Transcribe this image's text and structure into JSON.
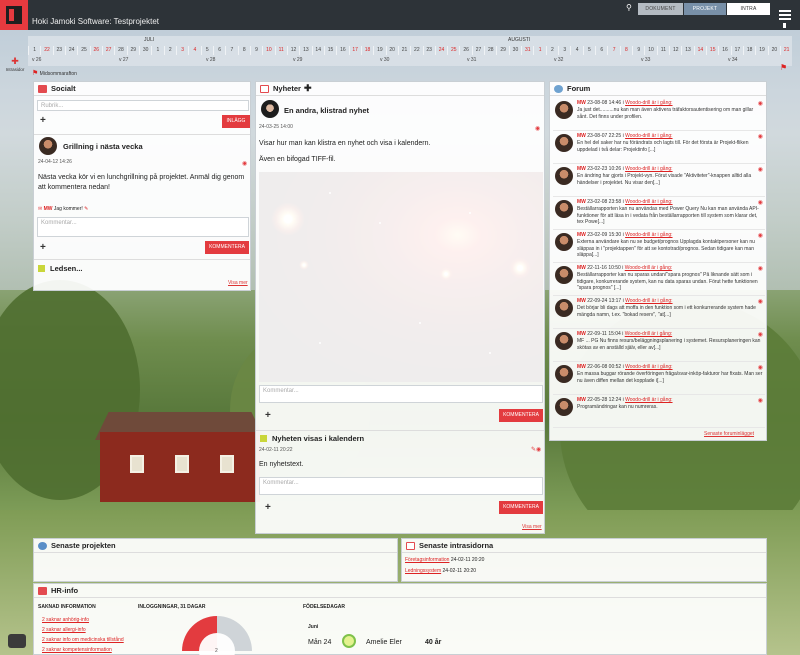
{
  "app": {
    "title": "Hoki Jamoki Software: Testprojektet"
  },
  "toptabs": [
    "DOKUMENT",
    "PROJEKT",
    "INTRA"
  ],
  "timeline": {
    "months": [
      "JULI",
      "AUGUSTI"
    ],
    "days": [
      "1",
      "22",
      "23",
      "24",
      "25",
      "26",
      "27",
      "28",
      "29",
      "30",
      "1",
      "2",
      "3",
      "4",
      "5",
      "6",
      "7",
      "8",
      "9",
      "10",
      "11",
      "12",
      "13",
      "14",
      "15",
      "16",
      "17",
      "18",
      "19",
      "20",
      "21",
      "22",
      "23",
      "24",
      "25",
      "26",
      "27",
      "28",
      "29",
      "30",
      "31",
      "1",
      "2",
      "3",
      "4",
      "5",
      "6",
      "7",
      "8",
      "9",
      "10",
      "11",
      "12",
      "13",
      "14",
      "15",
      "16",
      "17",
      "18",
      "19",
      "20",
      "21"
    ],
    "weeks": [
      "v 26",
      "v 27",
      "v 28",
      "v 29",
      "v 30",
      "v 31",
      "v 32",
      "v 33",
      "v 34"
    ],
    "left_label": "Intrasidor",
    "event": "Midsommarafton"
  },
  "social": {
    "title": "Socialt",
    "input_placeholder": "Rubrik...",
    "post_button": "INLÄGG",
    "post_title": "Grillning i nästa vecka",
    "post_date": "24-04-12 14:26",
    "post_text": "Nästa vecka kör vi en lunchgrillning på projektet. Anmäl dig genom att kommentera nedan!",
    "comment_author": "MW",
    "comment_text": "Jag kommer!",
    "comment_placeholder": "Kommentar...",
    "comment_button": "KOMMENTERA",
    "section2_title": "Ledsen...",
    "more_link": "Visa mer"
  },
  "news": {
    "title": "Nyheter",
    "item1_title": "En andra, klistrad nyhet",
    "item1_date": "24-03-25 14:00",
    "item1_text1": "Visar hur man kan klistra en nyhet och visa i kalendern.",
    "item1_text2": "Även en bifogad TIFF-fil.",
    "comment_placeholder": "Kommentar...",
    "comment_button": "KOMMENTERA",
    "item2_title": "Nyheten visas i kalendern",
    "item2_date": "24-02-11 20:22",
    "item2_text": "En nyhetstext.",
    "more_link": "Visa mer"
  },
  "forum": {
    "title": "Forum",
    "items": [
      {
        "meta_who": "MW",
        "meta_date": "23-08-08 14:46 i",
        "meta_link": "Woodo-drill är i gång:",
        "text": "Ja just det..........nu kan man även aktivera träfaktorsautentisering om man gillar sånt. Det finns under profilen."
      },
      {
        "meta_who": "MW",
        "meta_date": "23-08-07 22:25 i",
        "meta_link": "Woodo-drill är i gång:",
        "text": "En hel del saker har nu förändrats och lagts till. För det första är Projekt-fliken uppdelad i två delar: Projektinfo [...]"
      },
      {
        "meta_who": "MW",
        "meta_date": "23-02-23 10:26 i",
        "meta_link": "Woodo-drill är i gång:",
        "text": "En ändring har gjorts i Projekt-vyn. Förut visade \"Aktiviteter\"-knappen alltid alla händelser i projektet. Nu visar den[...]"
      },
      {
        "meta_who": "MW",
        "meta_date": "23-02-08 23:58 i",
        "meta_link": "Woodo-drill är i gång:",
        "text": "Beställarrapporten kan nu användas med Power Query Nu kan man använda API-funktioner för att läsa in i vedata från beställarrapporten till system som klarar det, tex Powe[...]"
      },
      {
        "meta_who": "MW",
        "meta_date": "23-02-09 15:30 i",
        "meta_link": "Woodo-drill är i gång:",
        "text": "Externa användare kan nu se budget/prognos Upplagda kontaktpersoner kan nu släppas in i \"projektappen\" för att se kontotrad/prognos. Sedan tidigare kan man släppa[...]"
      },
      {
        "meta_who": "MW",
        "meta_date": "22-11-16 10:50 i",
        "meta_link": "Woodo-drill är i gång:",
        "text": "Beställarrapporter kan nu sparas undan/\"spara prognos\" På liknande sätt som i tidigare, konkurrerande system, kan nu data sparas undan. Förut hette funktionen \"spara prognos\" [...]"
      },
      {
        "meta_who": "MW",
        "meta_date": "22-09-24 13:17 i",
        "meta_link": "Woodo-drill är i gång:",
        "text": "Det börjar bli dags att moffa in den funktion som i ett konkurrerande system hade mängda namn, t.ex. \"bokad reserv\", \"at[...]"
      },
      {
        "meta_who": "MW",
        "meta_date": "22-09-11 15:04 i",
        "meta_link": "Woodo-drill är i gång:",
        "text": "MF ... PG Nu finns resurs/beläggningsplanering i systemet. Resursplaneringen kan skötas av en anställd själv, eller av[...]"
      },
      {
        "meta_who": "MW",
        "meta_date": "22-06-08 00:52 i",
        "meta_link": "Woodo-drill är i gång:",
        "text": "En massa buggar rörande överföringen fråga/svar-inköp-fakturor har fixats. Man ser nu även diffen mellan det kopplade i[...]"
      },
      {
        "meta_who": "MW",
        "meta_date": "22-05-28 12:24 i",
        "meta_link": "Woodo-drill är i gång:",
        "text": "Programändringar kan nu numreras."
      }
    ],
    "more_link": "Senaste foruminlägget"
  },
  "projects": {
    "title": "Senaste projekten"
  },
  "intrasidor": {
    "title": "Senaste intrasidorna",
    "items": [
      {
        "name": "Företagsinformation",
        "date": "24-02-11 20:20"
      },
      {
        "name": "Ledningssystem",
        "date": "24-02-11 20:20"
      }
    ]
  },
  "hr": {
    "title": "HR-info",
    "missing_title": "SAKNAD INFORMATION",
    "missing_items": [
      "2 saknar anhörig-info",
      "2 saknar allergi-info",
      "2 saknar info om medicinska tillstånd",
      "2 saknar kompetensinformation"
    ],
    "logins_title": "INLOGGNINGAR, 31 DAGAR",
    "logins_value": "2",
    "birthdays_title": "FÖDELSEDAGAR",
    "birthday_month": "Juni",
    "birthday_day": "Mån 24",
    "birthday_name": "Amelie Eler",
    "birthday_age": "40 år"
  }
}
